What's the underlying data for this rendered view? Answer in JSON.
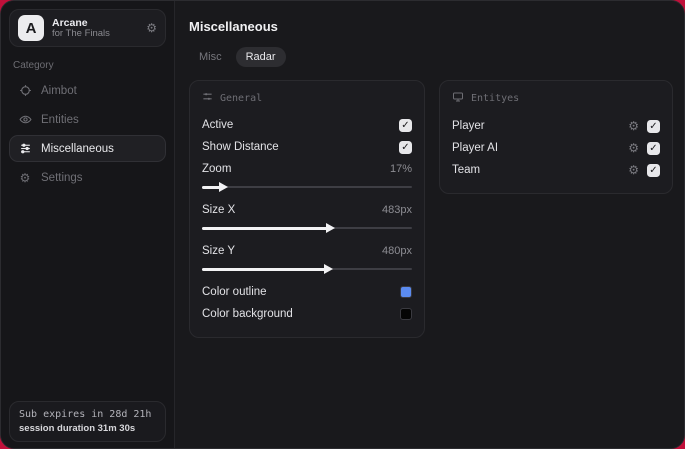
{
  "ui": {
    "check_glyph": "✓",
    "gear_glyph": "⚙"
  },
  "colors": {
    "accent_blue": "#5b8bf0",
    "swatch_black": "#050505",
    "desktop": "#c0103a"
  },
  "sidebar": {
    "brand": {
      "logo_letter": "A",
      "title": "Arcane",
      "subtitle": "for The Finals"
    },
    "category_label": "Category",
    "items": [
      {
        "label": "Aimbot",
        "selected": false
      },
      {
        "label": "Entities",
        "selected": false
      },
      {
        "label": "Miscellaneous",
        "selected": true
      },
      {
        "label": "Settings",
        "selected": false
      }
    ],
    "footer": {
      "line1": "Sub expires in 28d 21h",
      "line2": "session duration 31m 30s"
    }
  },
  "main": {
    "title": "Miscellaneous",
    "tabs": [
      {
        "label": "Misc",
        "active": false
      },
      {
        "label": "Radar",
        "active": true
      }
    ],
    "general": {
      "header": "General",
      "toggles": [
        {
          "label": "Active",
          "checked": true
        },
        {
          "label": "Show Distance",
          "checked": true
        }
      ],
      "sliders": [
        {
          "label": "Zoom",
          "value": "17%",
          "fill_pct": "9%"
        },
        {
          "label": "Size X",
          "value": "483px",
          "fill_pct": "60%"
        },
        {
          "label": "Size Y",
          "value": "480px",
          "fill_pct": "59%"
        }
      ],
      "colors": [
        {
          "label": "Color outline",
          "swatch": "#5b8bf0"
        },
        {
          "label": "Color background",
          "swatch": "#050505"
        }
      ]
    },
    "entities": {
      "header": "Entityes",
      "rows": [
        {
          "label": "Player",
          "checked": true
        },
        {
          "label": "Player AI",
          "checked": true
        },
        {
          "label": "Team",
          "checked": true
        }
      ]
    }
  }
}
